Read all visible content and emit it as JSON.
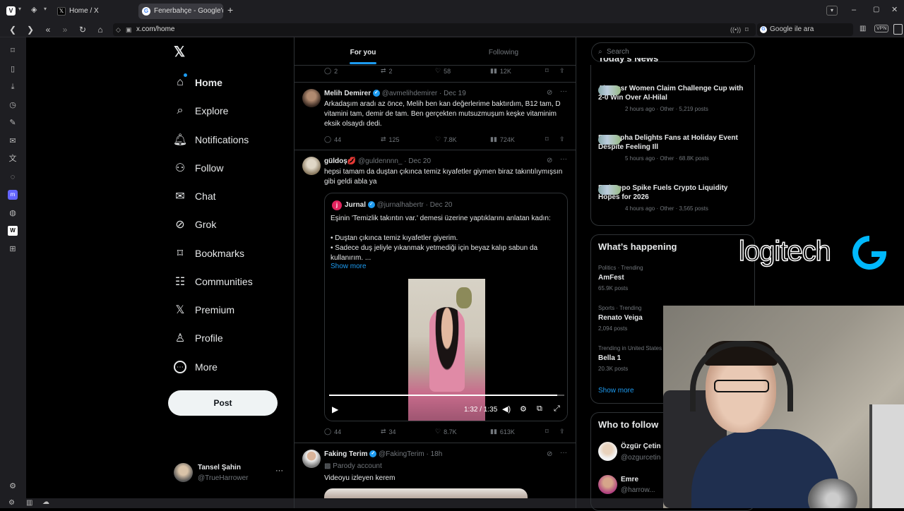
{
  "browser": {
    "tabs": [
      {
        "title": "Home / X",
        "active": false
      },
      {
        "title": "Fenerbahçe - Google'da Ara",
        "active": true
      }
    ],
    "url": "x.com/home",
    "search_placeholder": "Google ile ara",
    "vpn_label": "VPN"
  },
  "nav": {
    "items": [
      {
        "label": "Home",
        "icon": "home-icon"
      },
      {
        "label": "Explore",
        "icon": "search-icon"
      },
      {
        "label": "Notifications",
        "icon": "bell-icon"
      },
      {
        "label": "Follow",
        "icon": "add-user-icon"
      },
      {
        "label": "Chat",
        "icon": "mail-icon"
      },
      {
        "label": "Grok",
        "icon": "grok-icon"
      },
      {
        "label": "Bookmarks",
        "icon": "bookmark-icon"
      },
      {
        "label": "Communities",
        "icon": "people-icon"
      },
      {
        "label": "Premium",
        "icon": "x-icon"
      },
      {
        "label": "Profile",
        "icon": "person-icon"
      },
      {
        "label": "More",
        "icon": "more-circle-icon"
      }
    ],
    "post_label": "Post",
    "account": {
      "name": "Tansel Şahin",
      "handle": "@TrueHarrower"
    }
  },
  "feed": {
    "tabs": {
      "for_you": "For you",
      "following": "Following"
    },
    "top_actions": {
      "replies": "2",
      "reposts": "2",
      "likes": "58",
      "views": "12K"
    },
    "tweets": [
      {
        "name": "Melih Demirer",
        "handle": "@avmelihdemirer",
        "date": "Dec 19",
        "text": "Arkadaşım aradı az önce, Melih ben kan değerlerime baktırdım, B12 tam, D vitamini tam, demir de tam. Ben gerçekten mutsuzmuşum keşke vitaminim eksik olsaydı dedi.",
        "replies": "44",
        "reposts": "125",
        "likes": "7.8K",
        "views": "724K"
      },
      {
        "name": "güldoş💋",
        "handle": "@guldennnn_",
        "date": "Dec 20",
        "text": "hepsi tamam da duştan çıkınca temiz kıyafetler giymen biraz takıntılıymışsın gibi geldi abla ya",
        "quote": {
          "name": "Jurnal",
          "handle": "@jurnalhabertr",
          "date": "Dec 20",
          "line1": "Eşinin 'Temizlik takıntın var.' demesi üzerine yaptıklarını anlatan kadın:",
          "bullet1": "• Duştan çıkınca temiz kıyafetler giyerim.",
          "bullet2": "• Sadece duş jeliyle yıkanmak yetmediği için beyaz kalıp sabun da kullanırım. ...",
          "show_more": "Show more",
          "video_time": "1:32 / 1:35",
          "video_progress": 0.97
        },
        "replies": "44",
        "reposts": "34",
        "likes": "8.7K",
        "views": "613K"
      },
      {
        "name": "Faking Terim",
        "handle": "@FakingTerim",
        "date": "18h",
        "label": "Parody account",
        "text": "Videoyu izleyen kerem"
      }
    ]
  },
  "right": {
    "search_placeholder": "Search",
    "news_title": "Today's News",
    "news": [
      {
        "title": "Al-Nassr Women Claim Challenge Cup with 2-0 Win Over Al-Hilal",
        "meta": "2 hours ago · Other · 5,219 posts"
      },
      {
        "title": "Est Supha Delights Fans at Holiday Event Despite Feeling Ill",
        "meta": "5 hours ago · Other · 68.8K posts"
      },
      {
        "title": "Fed Repo Spike Fuels Crypto Liquidity Hopes for 2026",
        "meta": "4 hours ago · Other · 3,565 posts"
      }
    ],
    "happening_title": "What’s happening",
    "trends": [
      {
        "context": "Politics · Trending",
        "name": "AmFest",
        "posts": "65.9K posts"
      },
      {
        "context": "Sports · Trending",
        "name": "Renato Veiga",
        "posts": "2,094 posts"
      },
      {
        "context": "Trending in United States",
        "name": "Bella 1",
        "posts": "20.3K posts"
      }
    ],
    "show_more": "Show more",
    "who_to_follow": "Who to follow",
    "follow": [
      {
        "name": "Özgür Çetin",
        "handle": "@ozgurcetin"
      },
      {
        "name": "Emre",
        "handle": "@harrow..."
      }
    ]
  },
  "overlay": {
    "brand": "logitech"
  }
}
